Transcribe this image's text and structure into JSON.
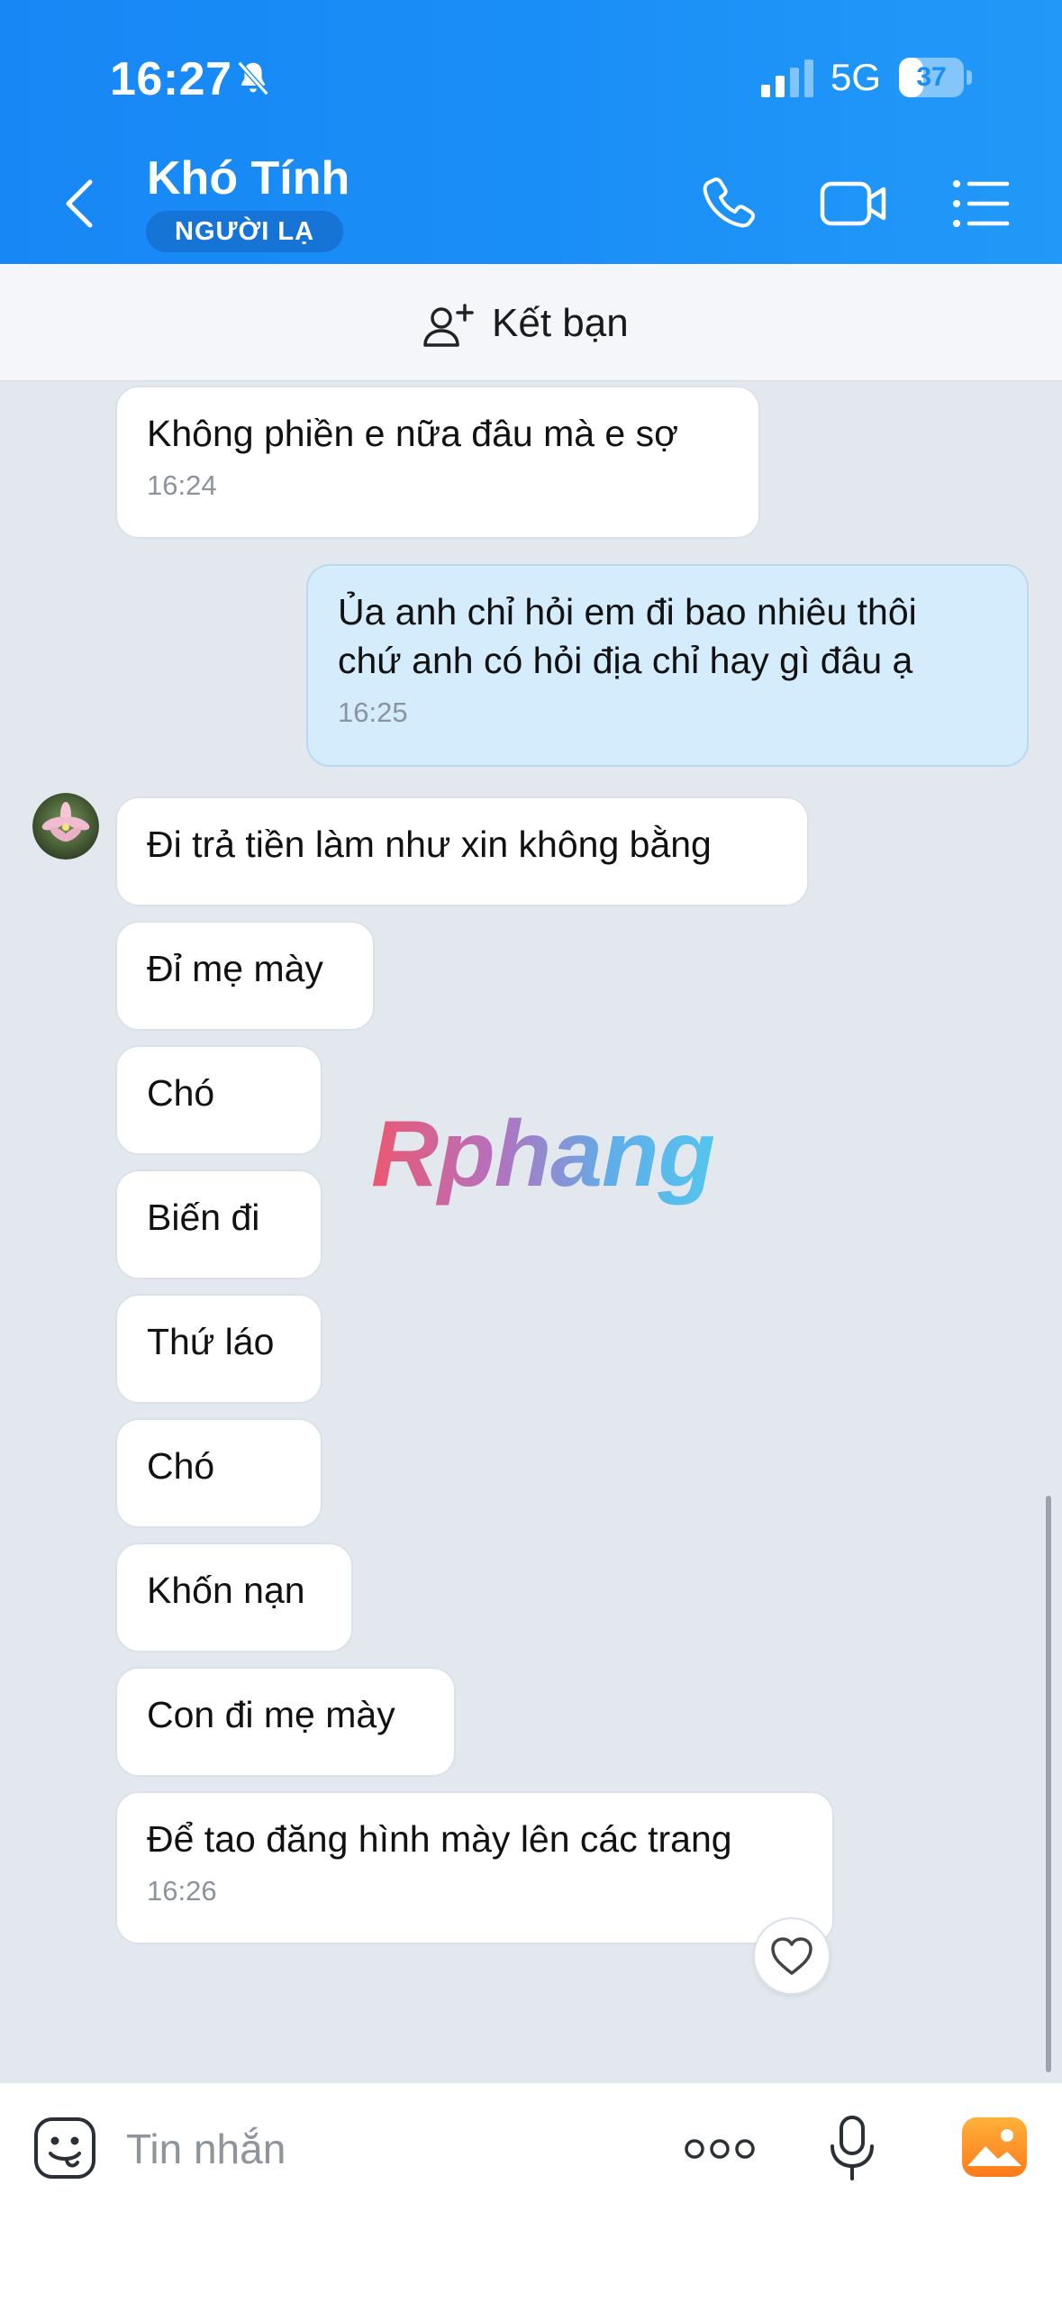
{
  "status": {
    "time": "16:27",
    "network": "5G",
    "battery": "37",
    "battery_level": 0.37
  },
  "header": {
    "title": "Khó Tính",
    "badge": "NGƯỜI LẠ"
  },
  "friend_bar": {
    "label": "Kết bạn"
  },
  "messages": [
    {
      "side": "them",
      "text": "Không phiền e nữa đâu mà e sợ",
      "time": "16:24"
    },
    {
      "side": "me",
      "text": "Ủa anh chỉ hỏi em đi bao nhiêu thôi\nchứ anh có hỏi địa chỉ hay gì đâu ạ",
      "time": "16:25"
    },
    {
      "side": "them",
      "text": "Đi trả tiền làm như xin không bằng"
    },
    {
      "side": "them",
      "text": "Đỉ mẹ mày"
    },
    {
      "side": "them",
      "text": "Chó"
    },
    {
      "side": "them",
      "text": "Biến đi"
    },
    {
      "side": "them",
      "text": "Thứ láo"
    },
    {
      "side": "them",
      "text": "Chó"
    },
    {
      "side": "them",
      "text": "Khốn nạn"
    },
    {
      "side": "them",
      "text": "Con đi mẹ mày"
    },
    {
      "side": "them",
      "text": "Để tao đăng hình mày lên các trang",
      "time": "16:26"
    }
  ],
  "watermark": "Rphang",
  "input": {
    "placeholder": "Tin nhắn"
  },
  "colors": {
    "header": "#1a8ef7",
    "my_bubble": "#d4ecfc",
    "their_bubble": "#ffffff",
    "chat_bg": "#e3e8ef"
  }
}
